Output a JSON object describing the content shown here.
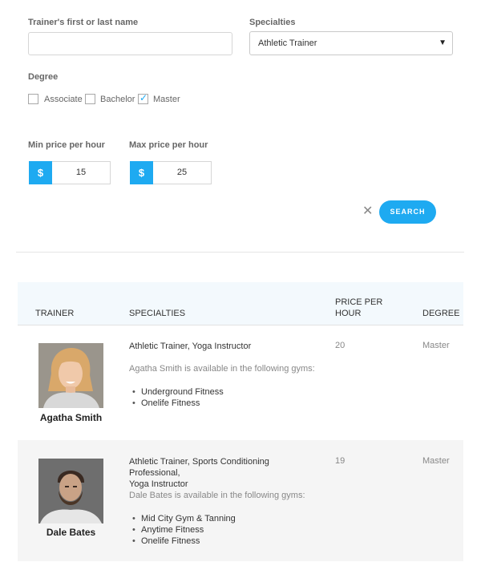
{
  "search_form": {
    "name_label": "Trainer's first or last name",
    "name_value": "",
    "specialties_label": "Specialties",
    "specialties_value": "Athletic Trainer",
    "degree_label": "Degree",
    "degrees": [
      {
        "label": "Associate",
        "checked": false
      },
      {
        "label": "Bachelor",
        "checked": false
      },
      {
        "label": "Master",
        "checked": true
      }
    ],
    "min_price_label": "Min price per hour",
    "max_price_label": "Max price per hour",
    "currency_symbol": "$",
    "min_price_value": "15",
    "max_price_value": "25",
    "clear_icon": "close-icon",
    "search_label": "SEARCH"
  },
  "table": {
    "headers": {
      "trainer": "TRAINER",
      "specialties": "SPECIALTIES",
      "price_line1": "PRICE PER",
      "price_line2": "HOUR",
      "degree": "DEGREE"
    },
    "rows": [
      {
        "name": "Agatha Smith",
        "specialties": "Athletic Trainer, Yoga Instructor",
        "availability": "Agatha Smith is available in the following gyms:",
        "gyms": [
          "Underground Fitness",
          "Onelife Fitness"
        ],
        "price": "20",
        "degree": "Master"
      },
      {
        "name": "Dale Bates",
        "specialties_line1": "Athletic Trainer, Sports Conditioning Professional,",
        "specialties_line2": "Yoga Instructor",
        "availability": "Dale Bates is available in the following gyms:",
        "gyms": [
          "Mid City Gym & Tanning",
          "Anytime Fitness",
          "Onelife Fitness"
        ],
        "price": "19",
        "degree": "Master"
      }
    ]
  },
  "colors": {
    "accent": "#1eaaf1",
    "header_bg": "#f3f9fd",
    "alt_row_bg": "#f5f5f5"
  }
}
